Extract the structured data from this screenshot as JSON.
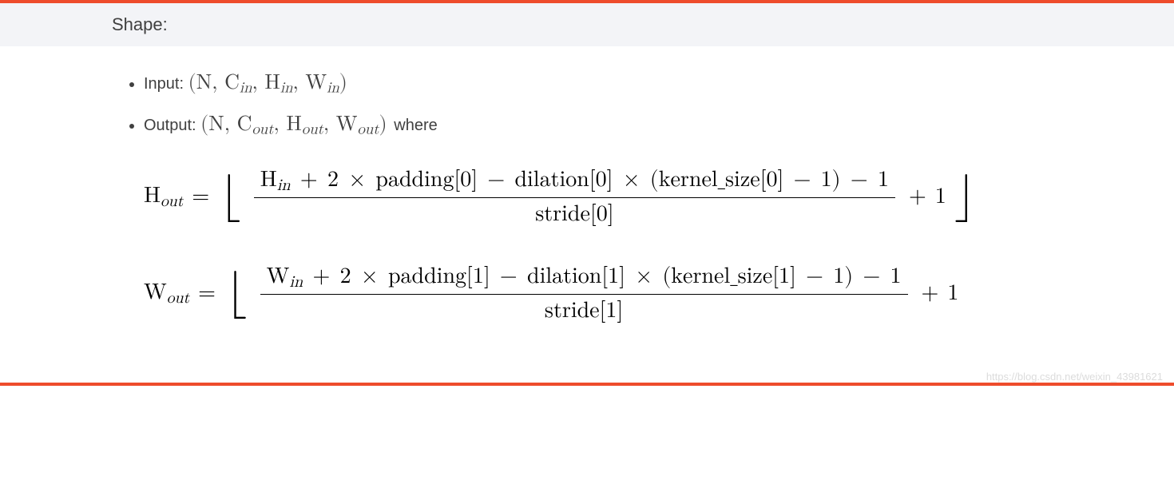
{
  "header": {
    "title": "Shape:"
  },
  "list": {
    "input_label": "Input: ",
    "output_label": "Output: ",
    "where": " where"
  },
  "math": {
    "N": "N",
    "Cin": "C",
    "Cin_sub": "in",
    "Hin": "H",
    "Hin_sub": "in",
    "Win": "W",
    "Win_sub": "in",
    "Cout": "C",
    "Cout_sub": "out",
    "Hout": "H",
    "Hout_sub": "out",
    "Wout": "W",
    "Wout_sub": "out",
    "eq": "=",
    "plus": "+",
    "minus": "−",
    "times": "×",
    "lpar": "(",
    "rpar": ")",
    "two": "2",
    "one": "1",
    "padding": "padding",
    "dilation": "dilation",
    "kernel": "kernel_size",
    "stride": "stride",
    "idx0": "[0]",
    "idx1": "[1]"
  },
  "floor": {
    "left": "⌊",
    "right": "⌋"
  },
  "watermark": "https://blog.csdn.net/weixin_43981621"
}
